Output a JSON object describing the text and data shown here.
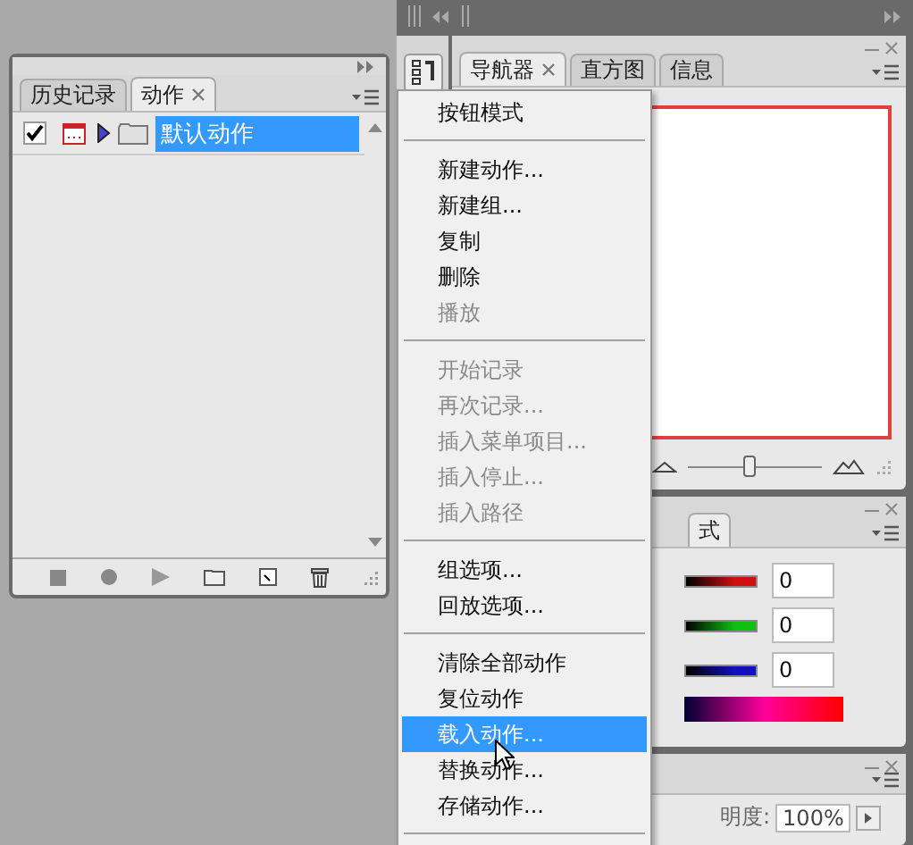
{
  "actions_panel": {
    "tabs": [
      {
        "label": "历史记录",
        "selected": false,
        "closable": false
      },
      {
        "label": "动作",
        "selected": true,
        "closable": true
      }
    ],
    "actions": [
      {
        "label": "默认动作",
        "checked": true,
        "dialog": true,
        "expanded": false,
        "selected": true
      }
    ]
  },
  "dock": {
    "navigator_panel": {
      "tabs": [
        {
          "label": "导航器",
          "selected": true,
          "closable": true
        },
        {
          "label": "直方图",
          "selected": false,
          "closable": false
        },
        {
          "label": "信息",
          "selected": false,
          "closable": false
        }
      ],
      "zoom": {
        "level": 0.45
      }
    },
    "color_panel": {
      "tab": "式",
      "channels": [
        {
          "color": "#d01010",
          "value": "0"
        },
        {
          "color": "#10c010",
          "value": "0"
        },
        {
          "color": "#1010c0",
          "value": "0"
        }
      ]
    },
    "layers_panel": {
      "opacity_label": "明度:",
      "opacity_value": "100%"
    }
  },
  "menu": {
    "groups": [
      [
        {
          "label": "按钮模式",
          "disabled": false,
          "selected": false
        }
      ],
      [
        {
          "label": "新建动作...",
          "disabled": false,
          "selected": false
        },
        {
          "label": "新建组...",
          "disabled": false,
          "selected": false
        },
        {
          "label": "复制",
          "disabled": false,
          "selected": false
        },
        {
          "label": "删除",
          "disabled": false,
          "selected": false
        },
        {
          "label": "播放",
          "disabled": true,
          "selected": false
        }
      ],
      [
        {
          "label": "开始记录",
          "disabled": true,
          "selected": false
        },
        {
          "label": "再次记录...",
          "disabled": true,
          "selected": false
        },
        {
          "label": "插入菜单项目...",
          "disabled": true,
          "selected": false
        },
        {
          "label": "插入停止...",
          "disabled": true,
          "selected": false
        },
        {
          "label": "插入路径",
          "disabled": true,
          "selected": false
        }
      ],
      [
        {
          "label": "组选项...",
          "disabled": false,
          "selected": false
        },
        {
          "label": "回放选项...",
          "disabled": false,
          "selected": false
        }
      ],
      [
        {
          "label": "清除全部动作",
          "disabled": false,
          "selected": false
        },
        {
          "label": "复位动作",
          "disabled": false,
          "selected": false
        },
        {
          "label": "载入动作...",
          "disabled": false,
          "selected": true
        },
        {
          "label": "替换动作...",
          "disabled": false,
          "selected": false
        },
        {
          "label": "存储动作...",
          "disabled": false,
          "selected": false
        }
      ]
    ]
  }
}
